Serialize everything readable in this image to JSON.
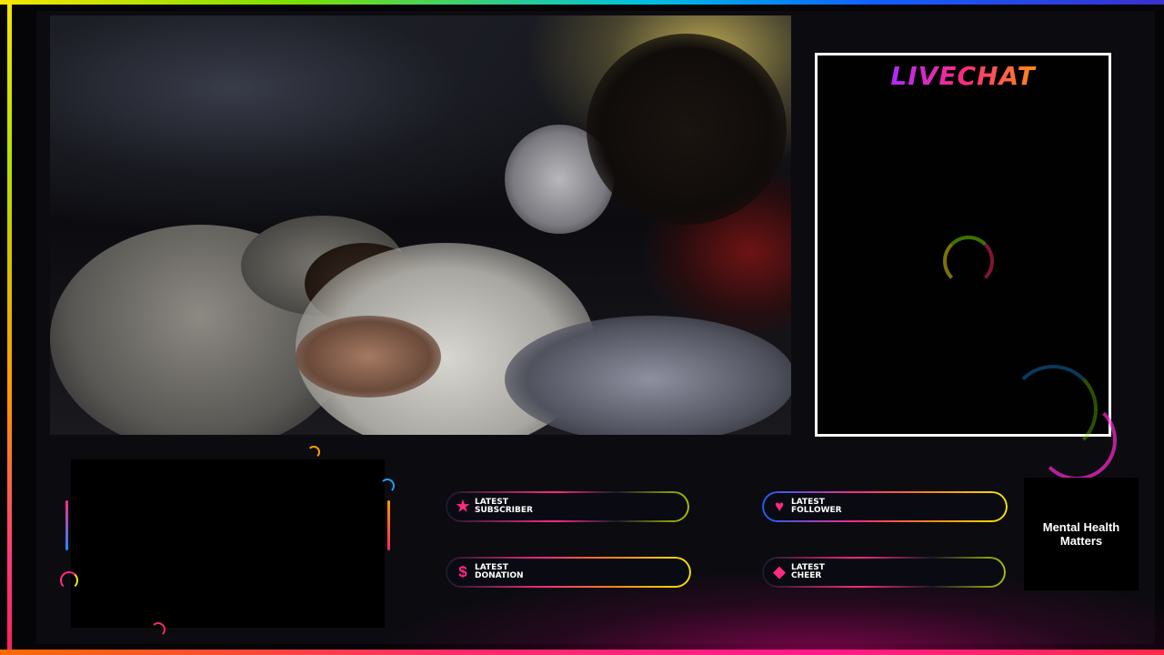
{
  "chat": {
    "title": "LIVECHAT"
  },
  "alerts": [
    {
      "line1": "LATEST",
      "line2": "SUBSCRIBER",
      "icon": "star-icon"
    },
    {
      "line1": "LATEST",
      "line2": "FOLLOWER",
      "icon": "heart-icon"
    },
    {
      "line1": "LATEST",
      "line2": "DONATION",
      "icon": "dollar-icon"
    },
    {
      "line1": "LATEST",
      "line2": "CHEER",
      "icon": "diamond-icon"
    }
  ],
  "mental_health": {
    "text": "Mental Health Matters"
  },
  "colors": {
    "accent_pink": "#ff2a80",
    "accent_yellow": "#f7e600",
    "accent_blue": "#1060ff"
  }
}
